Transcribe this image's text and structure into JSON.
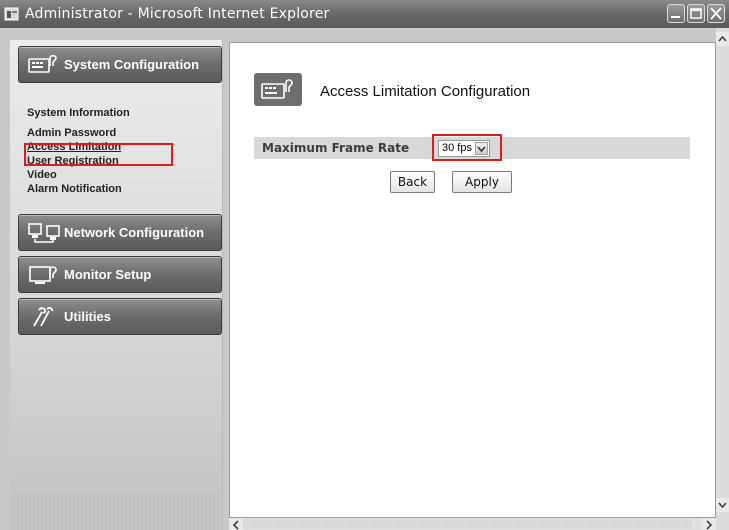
{
  "window": {
    "title": "Administrator - Microsoft Internet Explorer"
  },
  "sidebar": {
    "sections": [
      {
        "label": "System Configuration",
        "icon": "device-config-icon"
      },
      {
        "label": "Network Configuration",
        "icon": "network-computers-icon"
      },
      {
        "label": "Monitor Setup",
        "icon": "monitor-setup-icon"
      },
      {
        "label": "Utilities",
        "icon": "tools-icon"
      }
    ],
    "system_items": [
      "System Information",
      "Admin Password",
      "Access Limitation",
      "User Registration",
      "Video",
      "Alarm Notification"
    ],
    "active_item": "Access Limitation"
  },
  "content": {
    "page_title": "Access Limitation Configuration",
    "form": {
      "label": "Maximum Frame Rate",
      "selected_value": "30 fps"
    },
    "buttons": {
      "back": "Back",
      "apply": "Apply"
    }
  },
  "colors": {
    "highlight": "#e21a1a",
    "title_bar": "#6b6b6b",
    "section_button": "#6c6c6c",
    "form_row": "#d8d8d8"
  }
}
